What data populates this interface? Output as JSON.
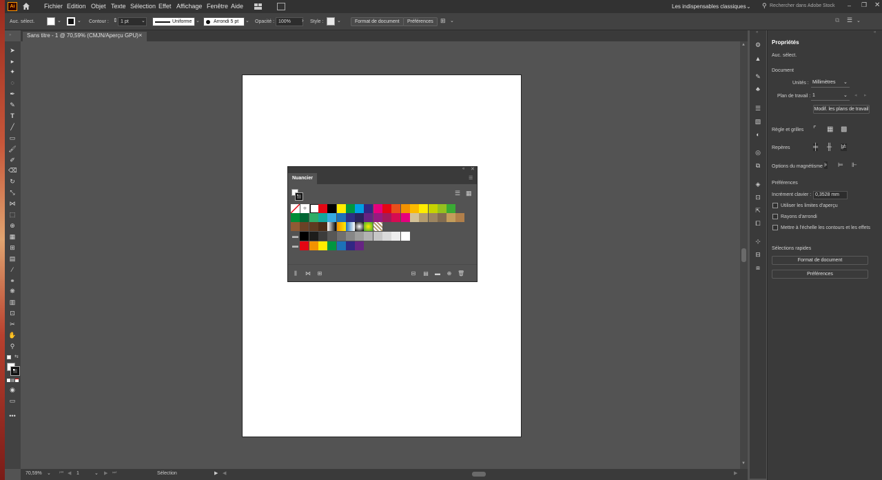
{
  "menubar": {
    "logo": "Ai",
    "items": [
      "Fichier",
      "Edition",
      "Objet",
      "Texte",
      "Sélection",
      "Effet",
      "Affichage",
      "Fenêtre",
      "Aide"
    ],
    "workspace": "Les indispensables classiques",
    "search_placeholder": "Rechercher dans Adobe Stock"
  },
  "controlbar": {
    "selection": "Auc. sélect.",
    "contour_label": "Contour :",
    "stroke_weight": "1 pt",
    "stroke_type": "Uniforme",
    "brush": "Arrondi 5 pt",
    "opacity_label": "Opacité :",
    "opacity_value": "100%",
    "style_label": "Style :",
    "doc_format_btn": "Format de document",
    "prefs_btn": "Préférences"
  },
  "document": {
    "tab_title": "Sans titre - 1 @ 70,59% (CMJN/Aperçu GPU)",
    "close": "×"
  },
  "statusbar": {
    "zoom": "70,59%",
    "artboard_num": "1",
    "tool": "Sélection"
  },
  "swatches_panel": {
    "title": "Nuancier",
    "colors_row1": [
      "#e30613",
      "#000000",
      "#ffed00",
      "#00963f",
      "#009fe3",
      "#312783",
      "#e5007d",
      "#e30613",
      "#e94e1b",
      "#f39200",
      "#fbba00",
      "#ffed00",
      "#c6d300",
      "#95c11f",
      "#3aaa35"
    ],
    "colors_row2": [
      "#008d36",
      "#006633",
      "#2fac66",
      "#13a89e",
      "#36a9e1",
      "#1d71b8",
      "#2d2e83",
      "#29235c",
      "#662483",
      "#951b81",
      "#a3195b",
      "#d60b52",
      "#e6007e",
      "#d3c297",
      "#b39b6e",
      "#9c8560",
      "#826c50",
      "#c39d5b",
      "#b17f4a"
    ],
    "colors_row3": [
      "#8f5b34",
      "#6b4226",
      "#5e3b20",
      "#4a2d17"
    ],
    "grays": [
      "#000000",
      "#1d1d1b",
      "#3c3c3b",
      "#575756",
      "#706f6f",
      "#878787",
      "#9d9d9c",
      "#b2b2b2",
      "#c6c6c6",
      "#dadada",
      "#ededed",
      "#ffffff"
    ],
    "brights": [
      "#e30613",
      "#f39200",
      "#ffed00",
      "#009640",
      "#1d71b8",
      "#312783",
      "#662483"
    ]
  },
  "properties": {
    "title": "Propriétés",
    "selection": "Auc. sélect.",
    "document_section": "Document",
    "units_label": "Unités :",
    "units_value": "Millimètres",
    "artboard_label": "Plan de travail :",
    "artboard_value": "1",
    "edit_artboards_btn": "Modif. les plans de travail",
    "rulers_label": "Règle et grilles",
    "guides_label": "Repères",
    "snap_label": "Options du magnétisme",
    "prefs_section": "Préférences",
    "keyboard_inc_label": "Incrément clavier :",
    "keyboard_inc_value": "0,3528 mm",
    "opt_preview_bounds": "Utiliser les limites d'aperçu",
    "opt_rounded_corners": "Rayons d'arrondi",
    "opt_scale_strokes": "Mettre à l'échelle les contours et les effets",
    "quick_actions": "Sélections rapides",
    "doc_format_btn": "Format de document",
    "prefs_btn": "Préférences"
  }
}
